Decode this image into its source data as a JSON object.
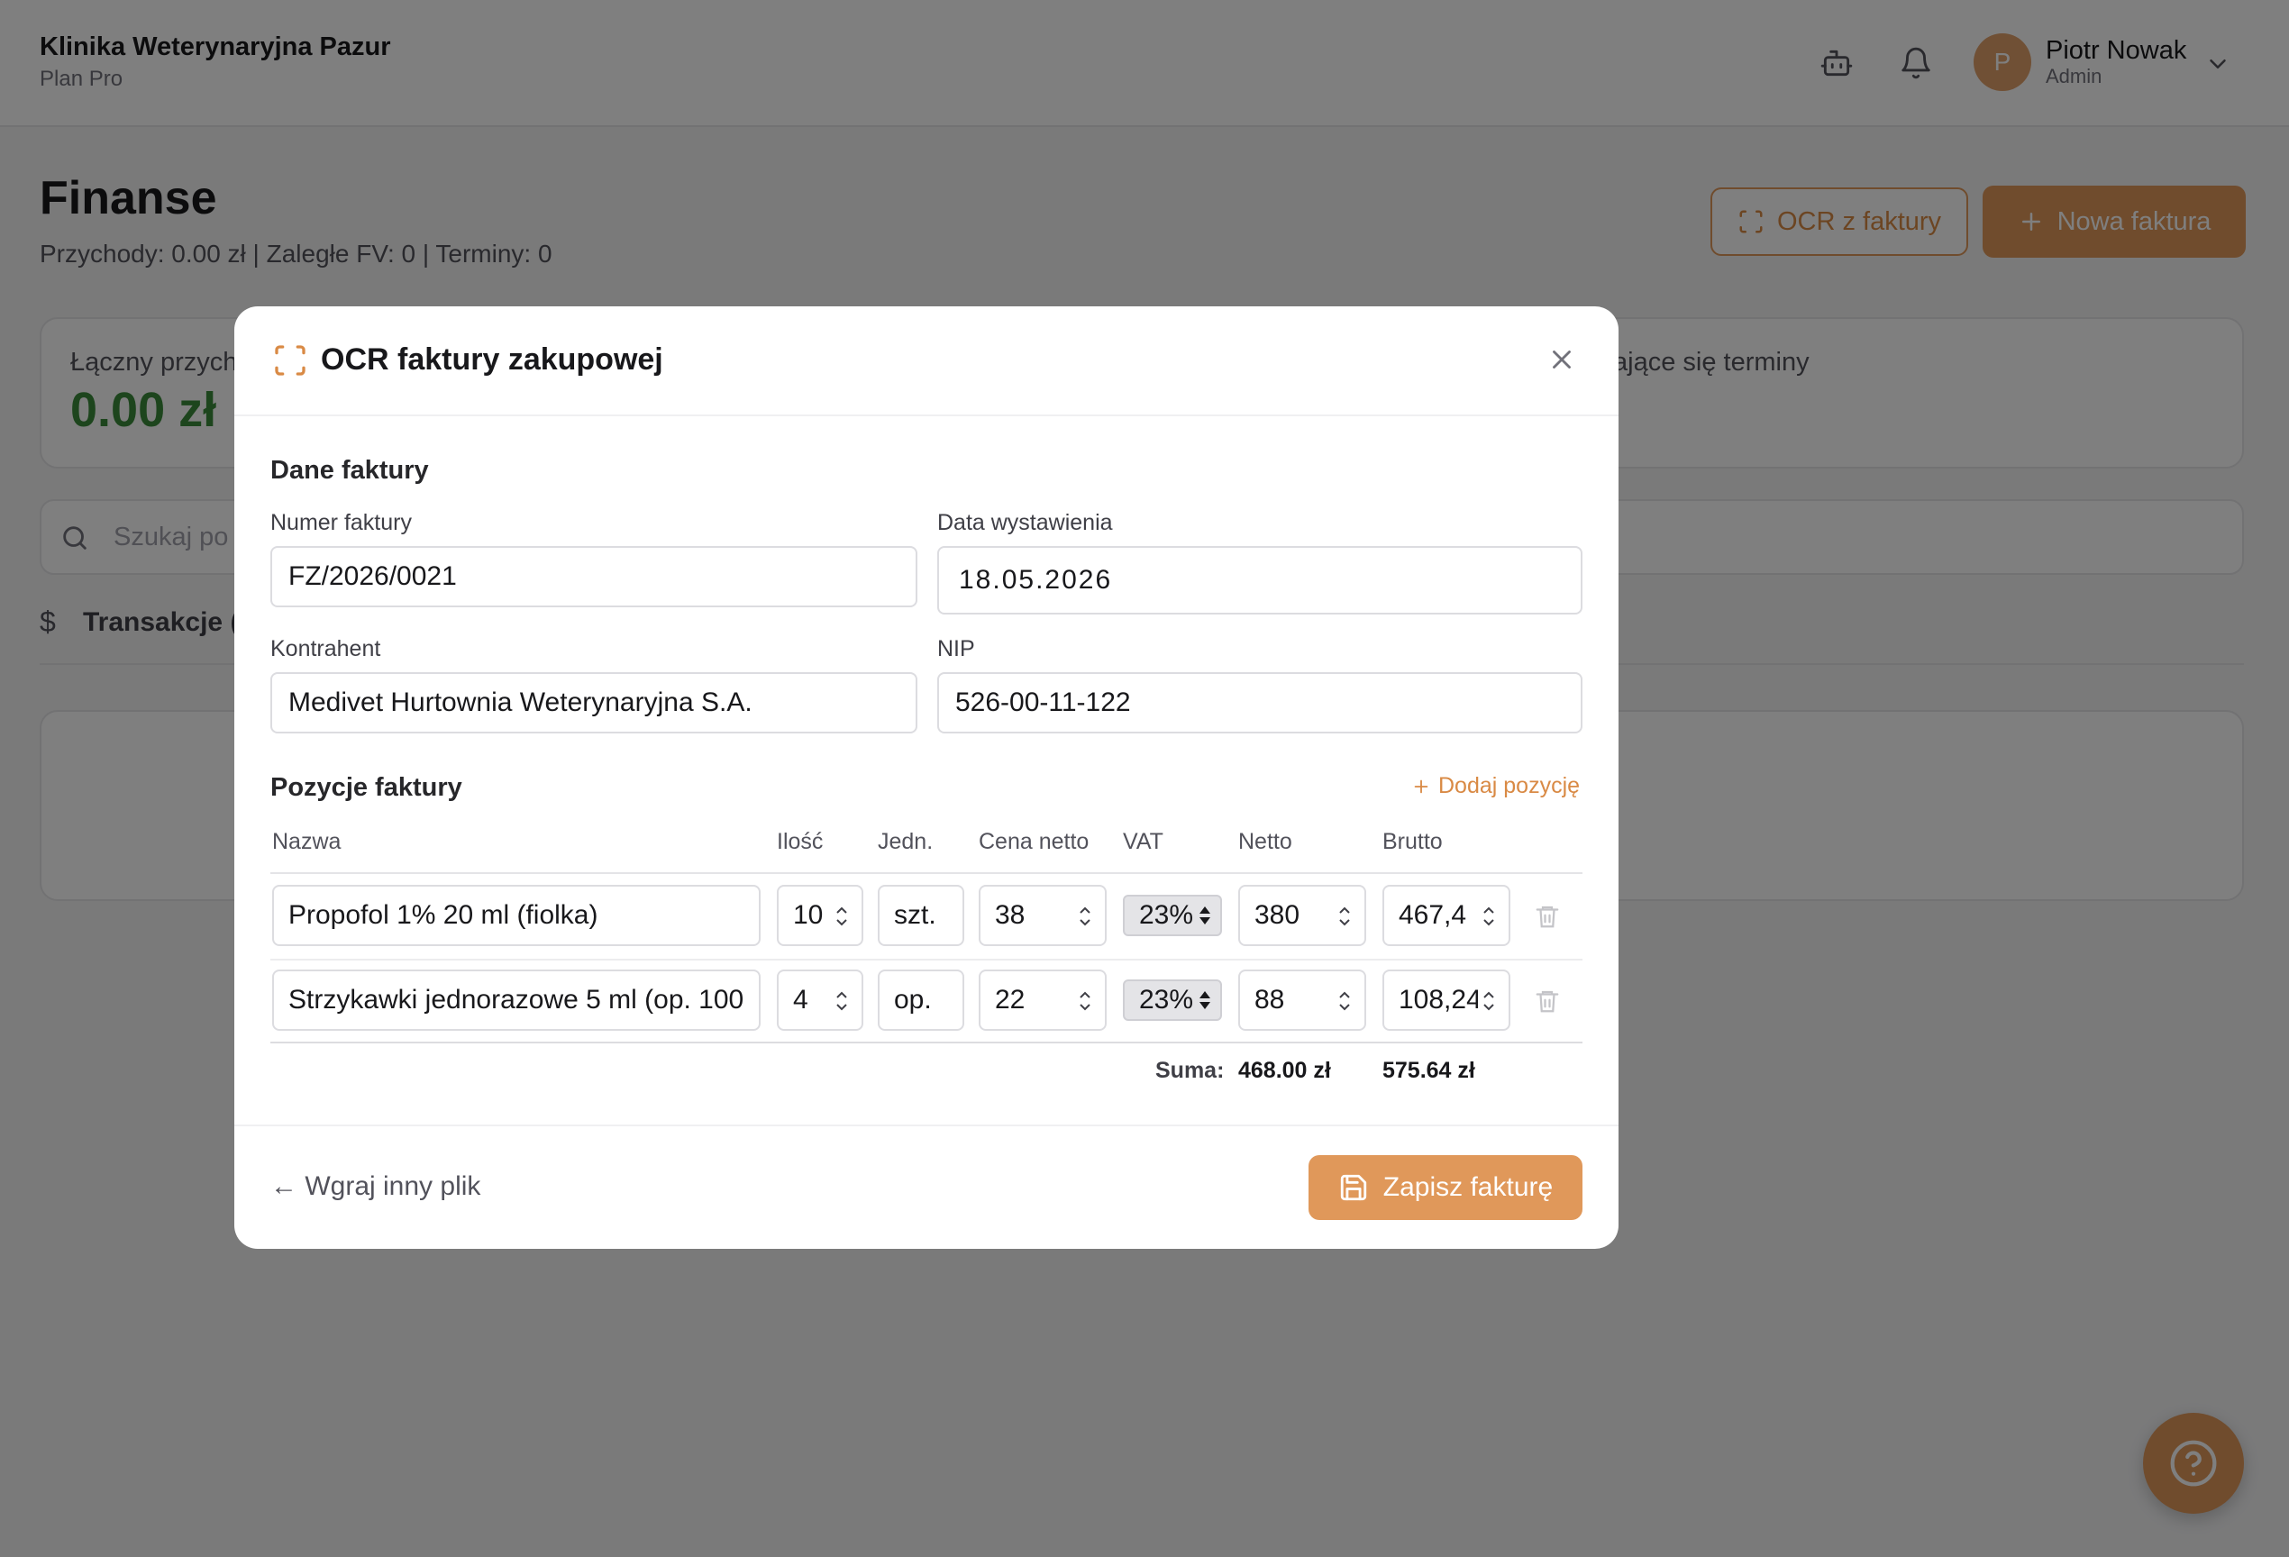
{
  "header": {
    "clinic_name": "Klinika Weterynaryjna Pazur",
    "plan": "Plan Pro",
    "user": {
      "initial": "P",
      "name": "Piotr Nowak",
      "role": "Admin"
    },
    "icons": [
      "bot-icon",
      "bell-icon",
      "chevron-down-icon"
    ]
  },
  "page": {
    "title": "Finanse",
    "stats": "Przychody: 0.00 zł | Zaległe FV: 0 | Terminy: 0",
    "ocr_button": "OCR z faktury",
    "new_invoice_button": "Nowa faktura",
    "cards": {
      "total_income_label": "Łączny przych",
      "total_income_value": "0.00 zł",
      "upcoming_label": "ające się terminy"
    },
    "search_placeholder": "Szukaj po",
    "transactions_label": "Transakcje (",
    "transactions_icon": "$"
  },
  "modal": {
    "title": "OCR faktury zakupowej",
    "section_invoice": "Dane faktury",
    "fields": {
      "number_label": "Numer faktury",
      "number_value": "FZ/2026/0021",
      "date_label": "Data wystawienia",
      "date_value": "18.05.2026",
      "contractor_label": "Kontrahent",
      "contractor_value": "Medivet Hurtownia Weterynaryjna S.A.",
      "nip_label": "NIP",
      "nip_value": "526-00-11-122"
    },
    "section_items": "Pozycje faktury",
    "add_item": "Dodaj pozycję",
    "columns": {
      "name": "Nazwa",
      "qty": "Ilość",
      "unit": "Jedn.",
      "net_price": "Cena netto",
      "vat": "VAT",
      "net": "Netto",
      "gross": "Brutto"
    },
    "items": [
      {
        "name": "Propofol 1% 20 ml (fiolka)",
        "qty": "10",
        "unit": "szt.",
        "net_price": "38",
        "vat": "23%",
        "net": "380",
        "gross": "467,4"
      },
      {
        "name": "Strzykawki jednorazowe 5 ml (op. 100",
        "qty": "4",
        "unit": "op.",
        "net_price": "22",
        "vat": "23%",
        "net": "88",
        "gross": "108,24"
      }
    ],
    "sum_label": "Suma:",
    "sum_net": "468.00 zł",
    "sum_gross": "575.64 zł",
    "back_link": "← Wgraj inny plik",
    "save_button": "Zapisz fakturę"
  },
  "colors": {
    "accent": "#e0985a",
    "positive": "#3a8a3a"
  }
}
